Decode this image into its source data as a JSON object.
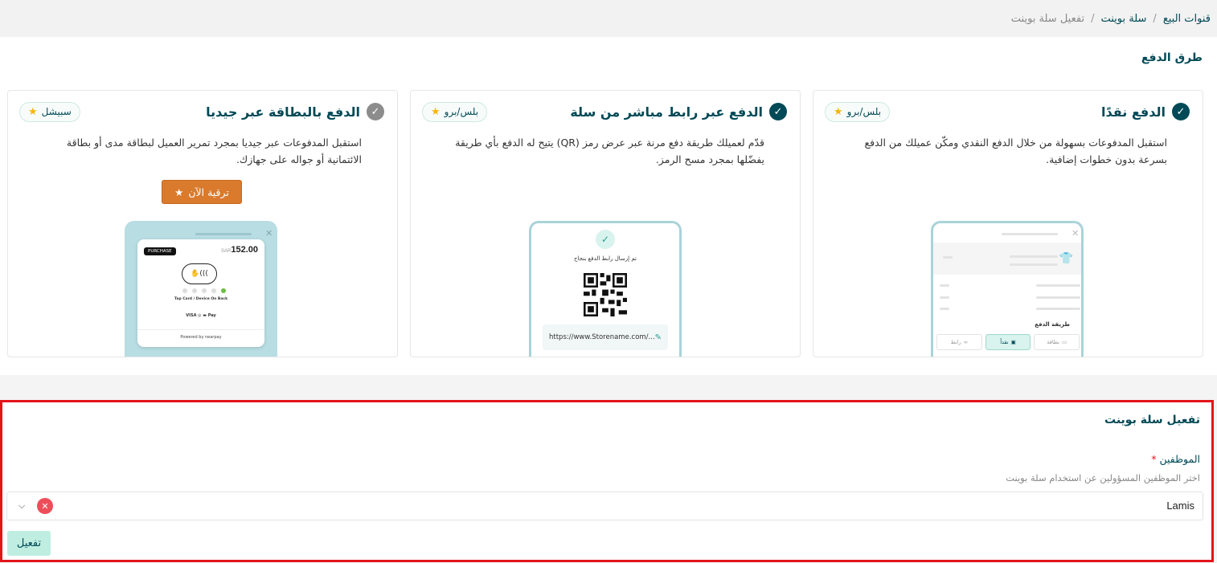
{
  "breadcrumb": {
    "items": [
      "قنوات البيع",
      "سلة بوينت"
    ],
    "current": "تفعيل سلة بوينت",
    "separator": "/"
  },
  "payment_methods": {
    "title": "طرق الدفع",
    "cards": [
      {
        "title": "الدفع نقدًا",
        "badge": "بلس/برو",
        "description": "استقبل المدفوعات بسهولة من خلال الدفع النقدي ومكّن عميلك من الدفع بسرعة بدون خطوات إضافية.",
        "mockup": {
          "label": "طريقة الدفع",
          "tabs": [
            "بطاقة",
            "نقداً",
            "رابط"
          ]
        }
      },
      {
        "title": "الدفع عبر رابط مباشر من سلة",
        "badge": "بلس/برو",
        "description": "قدّم لعميلك طريقة دفع مرنة عبر عرض رمز (QR) يتيح له الدفع بأي طريقة يفضّلها بمجرد مسح الرمز.",
        "mockup": {
          "sent_text": "تم إرسال رابط الدفع بنجاح",
          "link": "https://www.Storename.com/..."
        }
      },
      {
        "title": "الدفع بالبطاقة عبر جيديا",
        "badge": "سبيشل",
        "description": "استقبل المدفوعات عبر جيديا بمجرد تمرير العميل لبطاقة مدى أو بطاقة الائتمانية أو جواله على جهازك.",
        "upgrade_label": "ترقية الآن",
        "mockup": {
          "tag": "PURCHASE",
          "currency": "SAR",
          "amount": "152.00",
          "tap_text": "Tap Card / Device On Back",
          "logos": "VISA  ◎  ▬  Pay",
          "powered": "Powered by  nearpay"
        }
      }
    ]
  },
  "activation": {
    "title": "تفعيل سلة بوينت",
    "employees_label": "الموظفين",
    "required_mark": "*",
    "employees_help": "اختر الموظفين المسؤولين عن استخدام سلة بوينت",
    "selected_employee": "Lamis",
    "activate_label": "تفعيل"
  },
  "colors": {
    "primary": "#004956",
    "accent": "#bfeee1",
    "upgrade": "#d97a2d",
    "highlight_border": "#e4141b"
  }
}
